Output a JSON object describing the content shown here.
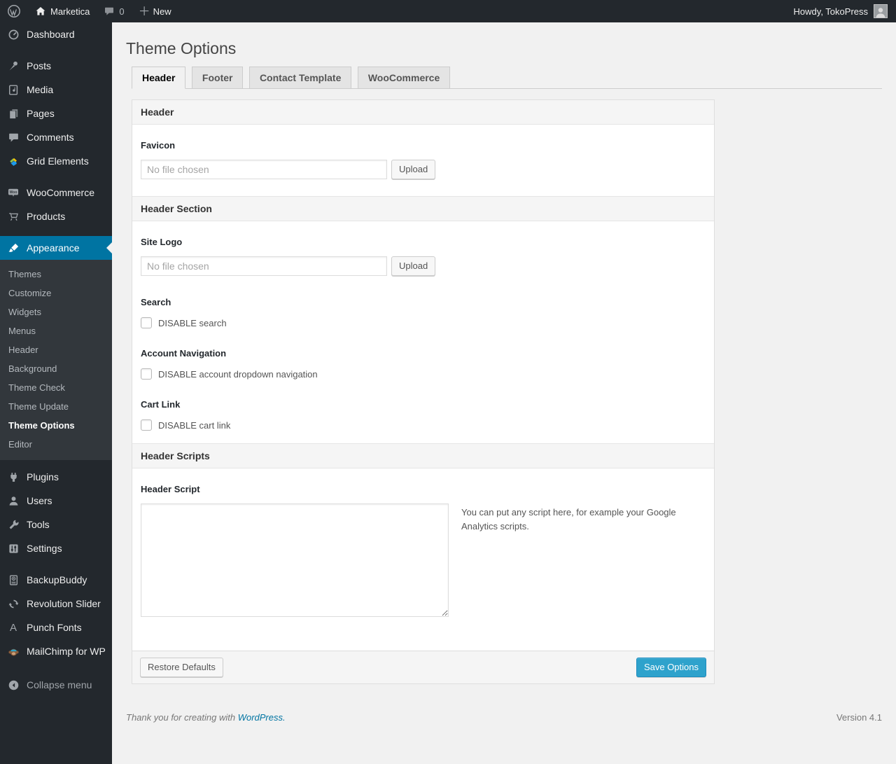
{
  "admin_bar": {
    "site_name": "Marketica",
    "comment_count": "0",
    "new_label": "New",
    "howdy_text": "Howdy, TokoPress"
  },
  "sidebar": {
    "items": [
      {
        "label": "Dashboard"
      },
      {
        "label": "Posts"
      },
      {
        "label": "Media"
      },
      {
        "label": "Pages"
      },
      {
        "label": "Comments"
      },
      {
        "label": "Grid Elements"
      },
      {
        "label": "WooCommerce"
      },
      {
        "label": "Products"
      },
      {
        "label": "Appearance"
      },
      {
        "label": "Plugins"
      },
      {
        "label": "Users"
      },
      {
        "label": "Tools"
      },
      {
        "label": "Settings"
      },
      {
        "label": "BackupBuddy"
      },
      {
        "label": "Revolution Slider"
      },
      {
        "label": "Punch Fonts"
      },
      {
        "label": "MailChimp for WP"
      },
      {
        "label": "Collapse menu"
      }
    ],
    "submenu": [
      "Themes",
      "Customize",
      "Widgets",
      "Menus",
      "Header",
      "Background",
      "Theme Check",
      "Theme Update",
      "Theme Options",
      "Editor"
    ],
    "current_item": "Appearance",
    "current_submenu_item": "Theme Options"
  },
  "page": {
    "title": "Theme Options",
    "tabs": [
      {
        "label": "Header",
        "active": true
      },
      {
        "label": "Footer",
        "active": false
      },
      {
        "label": "Contact Template",
        "active": false
      },
      {
        "label": "WooCommerce",
        "active": false
      }
    ]
  },
  "panel": {
    "sections": [
      {
        "title": "Header"
      },
      {
        "title": "Header Section"
      },
      {
        "title": "Header Scripts"
      }
    ],
    "fields": {
      "favicon": {
        "label": "Favicon",
        "file_text": "No file chosen",
        "button": "Upload"
      },
      "site_logo": {
        "label": "Site Logo",
        "file_text": "No file chosen",
        "button": "Upload"
      },
      "search": {
        "label": "Search",
        "checkbox_label": "DISABLE search",
        "checked": false
      },
      "account_nav": {
        "label": "Account Navigation",
        "checkbox_label": "DISABLE account dropdown navigation",
        "checked": false
      },
      "cart_link": {
        "label": "Cart Link",
        "checkbox_label": "DISABLE cart link",
        "checked": false
      },
      "header_script": {
        "label": "Header Script",
        "value": "",
        "description": "You can put any script here, for example your Google Analytics scripts."
      }
    },
    "footer": {
      "restore_label": "Restore Defaults",
      "save_label": "Save Options"
    }
  },
  "page_footer": {
    "thanks_text": "Thank you for creating with",
    "link_label": "WordPress.",
    "version": "Version 4.1"
  },
  "colors": {
    "admin_bar_bg": "#23282d",
    "submenu_bg": "#32373c",
    "accent": "#0074a2",
    "primary_button": "#2ea2cc",
    "content_bg": "#f1f1f1"
  }
}
